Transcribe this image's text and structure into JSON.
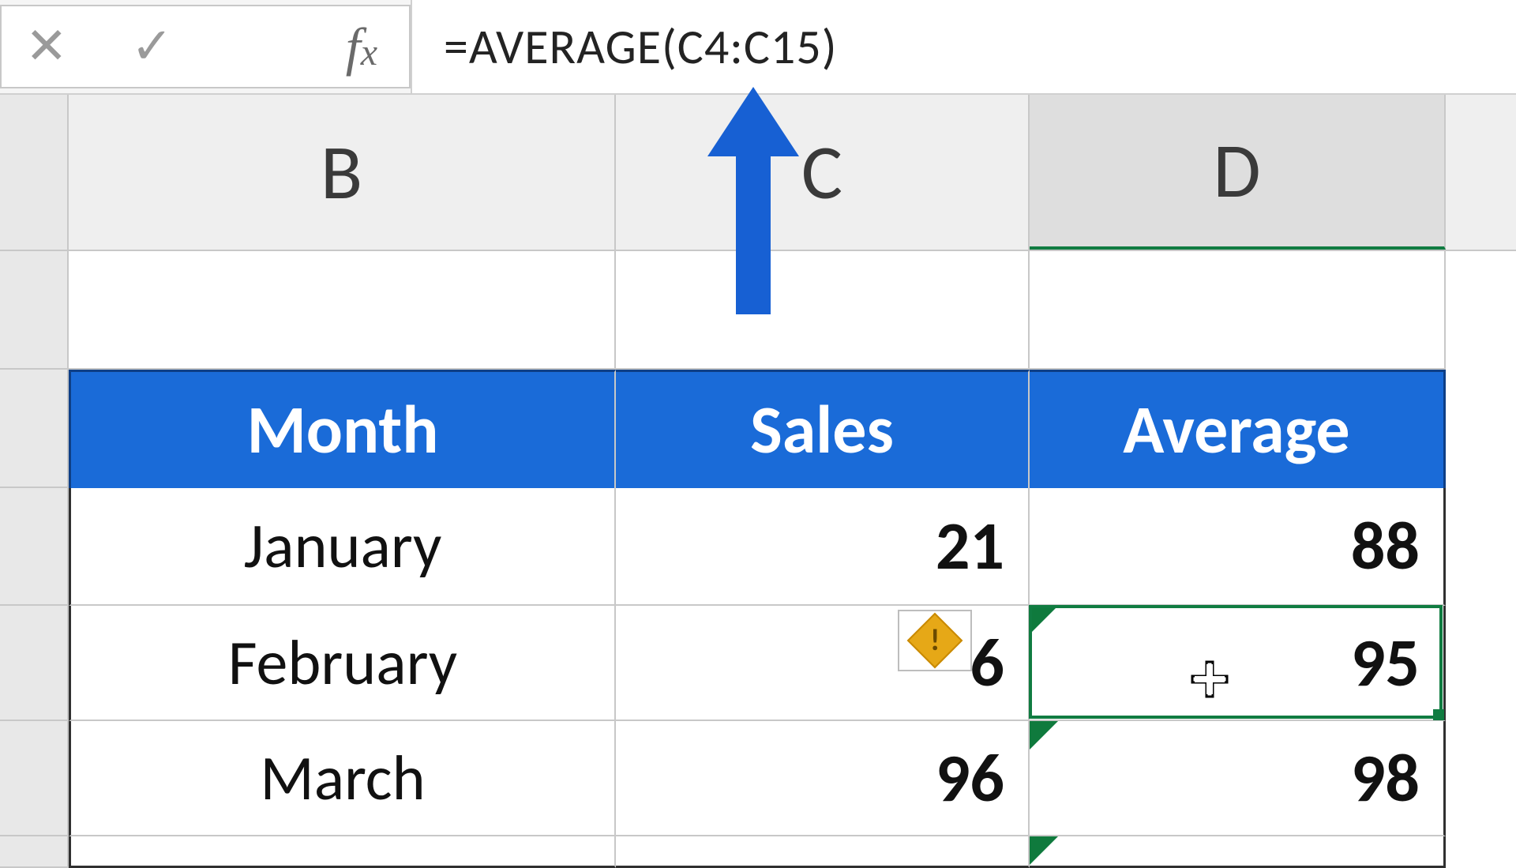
{
  "formula_bar": {
    "formula": "=AVERAGE(C4:C15)",
    "fx_label": "f"
  },
  "columns": {
    "B": "B",
    "C": "C",
    "D": "D"
  },
  "table": {
    "headers": {
      "month": "Month",
      "sales": "Sales",
      "average": "Average"
    },
    "rows": [
      {
        "month": "January",
        "sales": "21",
        "average": "88"
      },
      {
        "month": "February",
        "sales": "6",
        "average": "95"
      },
      {
        "month": "March",
        "sales": "96",
        "average": "98"
      }
    ]
  },
  "error_tag": {
    "symbol": "!"
  }
}
